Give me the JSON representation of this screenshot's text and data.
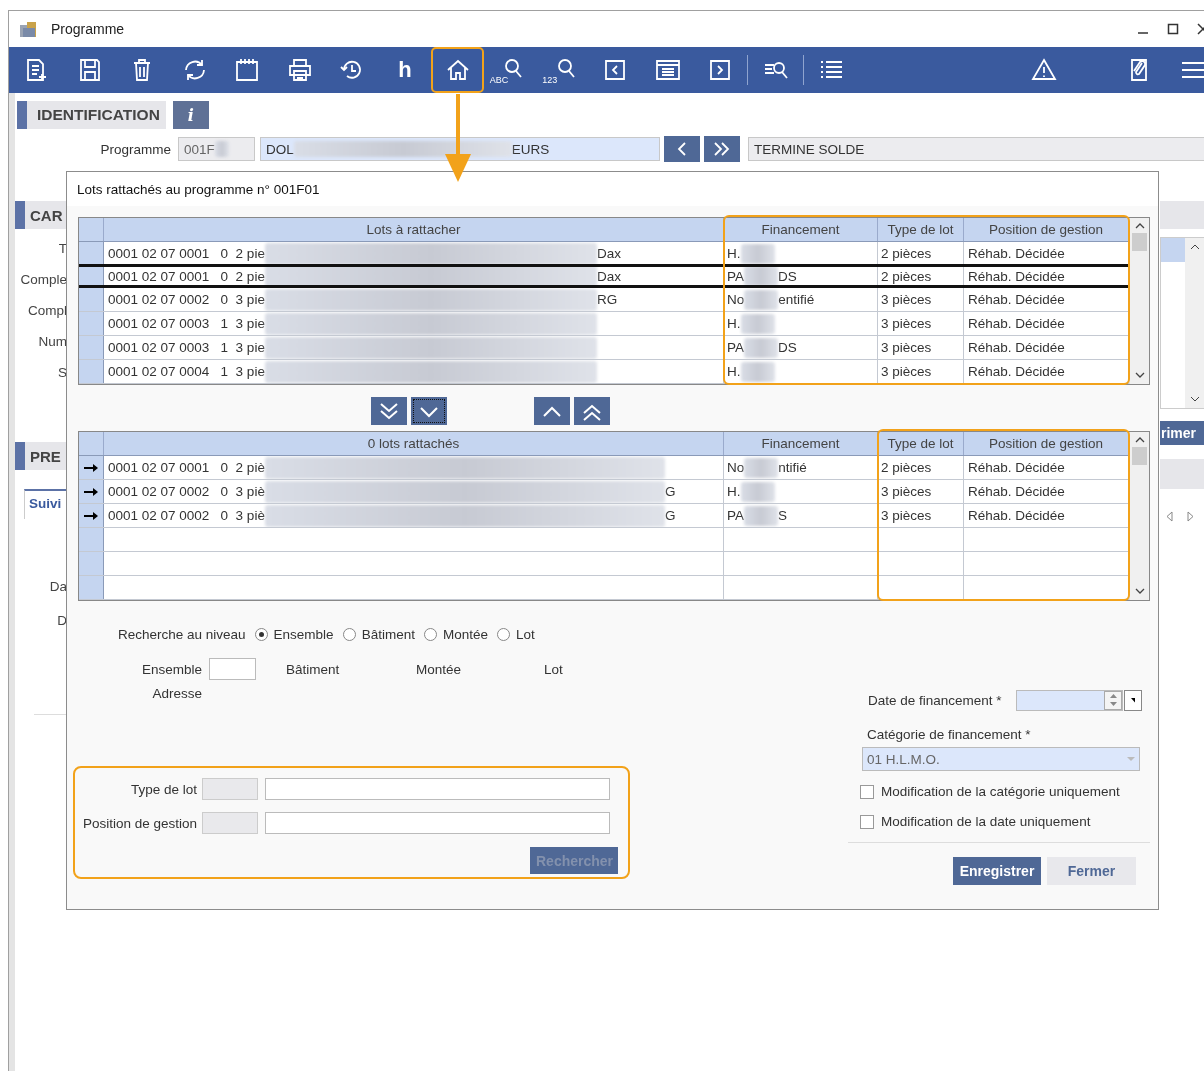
{
  "window": {
    "title": "Programme"
  },
  "toolbar": [
    {
      "kind": "new-document",
      "highlighted": false
    },
    {
      "kind": "save",
      "highlighted": false
    },
    {
      "kind": "trash",
      "highlighted": false
    },
    {
      "kind": "refresh",
      "highlighted": false
    },
    {
      "kind": "calendar",
      "highlighted": false
    },
    {
      "kind": "printer",
      "highlighted": false
    },
    {
      "kind": "history",
      "highlighted": false
    },
    {
      "kind": "letter",
      "label": "h",
      "highlighted": false
    },
    {
      "kind": "home",
      "highlighted": true
    },
    {
      "kind": "search-text",
      "label": "ABC",
      "highlighted": false
    },
    {
      "kind": "search-number",
      "label": "123",
      "highlighted": false
    },
    {
      "kind": "previous",
      "highlighted": false
    },
    {
      "kind": "window-list",
      "highlighted": false
    },
    {
      "kind": "next",
      "highlighted": false
    },
    {
      "kind": "separator"
    },
    {
      "kind": "filter-search",
      "highlighted": false
    },
    {
      "kind": "separator"
    },
    {
      "kind": "list",
      "highlighted": false
    },
    {
      "kind": "warning",
      "highlighted": false
    },
    {
      "kind": "attachment",
      "highlighted": false
    },
    {
      "kind": "menu",
      "highlighted": false
    }
  ],
  "identification": {
    "title": "IDENTIFICATION",
    "info": "i",
    "program_label": "Programme",
    "code": "001F",
    "name_start": "DOL",
    "name_end": "EURS",
    "status": "TERMINE SOLDE"
  },
  "background": {
    "section_1": "CAR",
    "labels_1": [
      "T",
      "Comple",
      "Compl",
      "Num",
      "S"
    ],
    "section_2": "PRE",
    "tab": "Suivi",
    "labels_2": [
      "Da",
      "D"
    ],
    "button": "rimer"
  },
  "dialog": {
    "title": "Lots rattachés au programme n° 001F01",
    "available": {
      "columns": [
        {
          "label": "Lots à rattacher",
          "highlighted": false
        },
        {
          "label": "Financement",
          "highlighted": true
        },
        {
          "label": "Type de lot",
          "highlighted": true
        },
        {
          "label": "Position de gestion",
          "highlighted": true
        }
      ],
      "rows": [
        {
          "lot": "0001 02 07 0001   0  2 pie",
          "lot_end": "Dax",
          "fin_start": "H.",
          "fin_end": "",
          "type": "2 pièces",
          "position": "Réhab. Décidée",
          "selected": false,
          "current": false
        },
        {
          "lot": "0001 02 07 0001   0  2 pie",
          "lot_end": "Dax",
          "fin_start": "PA",
          "fin_end": "DS",
          "type": "2 pièces",
          "position": "Réhab. Décidée",
          "selected": true,
          "current": false
        },
        {
          "lot": "0001 02 07 0002   0  3 pie",
          "lot_end": "RG",
          "fin_start": "No",
          "fin_end": "entifié",
          "type": "3 pièces",
          "position": "Réhab. Décidée",
          "selected": false,
          "current": false
        },
        {
          "lot": "0001 02 07 0003   1  3 pie",
          "lot_end": "",
          "fin_start": "H.",
          "fin_end": "",
          "type": "3 pièces",
          "position": "Réhab. Décidée",
          "selected": false,
          "current": false
        },
        {
          "lot": "0001 02 07 0003   1  3 pie",
          "lot_end": "",
          "fin_start": "PA",
          "fin_end": "DS",
          "type": "3 pièces",
          "position": "Réhab. Décidée",
          "selected": false,
          "current": false
        },
        {
          "lot": "0001 02 07 0004   1  3 pie",
          "lot_end": "",
          "fin_start": "H.",
          "fin_end": "",
          "type": "3 pièces",
          "position": "Réhab. Décidée",
          "selected": false,
          "current": false
        }
      ]
    },
    "attached": {
      "columns": [
        {
          "label": "0 lots rattachés",
          "highlighted": false
        },
        {
          "label": "Financement",
          "highlighted": false
        },
        {
          "label": "Type de lot",
          "highlighted": true
        },
        {
          "label": "Position de gestion",
          "highlighted": true
        }
      ],
      "rows": [
        {
          "lot": "0001 02 07 0001   0  2 piè",
          "lot_end": "",
          "fin_start": "No",
          "fin_end": "ntifié",
          "type": "2 pièces",
          "position": "Réhab. Décidée",
          "selected": false,
          "current": true
        },
        {
          "lot": "0001 02 07 0002   0  3 piè",
          "lot_end": "G",
          "fin_start": "H.",
          "fin_end": "",
          "type": "3 pièces",
          "position": "Réhab. Décidée",
          "selected": false,
          "current": true
        },
        {
          "lot": "0001 02 07 0002   0  3 piè",
          "lot_end": "G",
          "fin_start": "PA",
          "fin_end": "S",
          "type": "3 pièces",
          "position": "Réhab. Décidée",
          "selected": false,
          "current": true
        }
      ]
    },
    "move_buttons": [
      {
        "kind": "all-down",
        "focused": false
      },
      {
        "kind": "down",
        "focused": true
      },
      {
        "kind": "up",
        "focused": false
      },
      {
        "kind": "all-up",
        "focused": false
      }
    ],
    "search": {
      "level_label": "Recherche au niveau",
      "levels": [
        {
          "label": "Ensemble",
          "selected": true
        },
        {
          "label": "Bâtiment",
          "selected": false
        },
        {
          "label": "Montée",
          "selected": false
        },
        {
          "label": "Lot",
          "selected": false
        }
      ],
      "ensemble_label": "Ensemble",
      "batiment_label": "Bâtiment",
      "montee_label": "Montée",
      "lot_label": "Lot",
      "address_label": "Adresse",
      "highlighted": true,
      "type_label": "Type de lot",
      "position_label": "Position de gestion",
      "button": {
        "label": "Rechercher",
        "disabled": true
      }
    },
    "financing": {
      "date_label": "Date de financement *",
      "category_label": "Catégorie de financement *",
      "category": "01 H.L.M.O.",
      "options": [
        {
          "label": "Modification de la catégorie uniquement",
          "checked": false
        },
        {
          "label": "Modification de la date uniquement",
          "checked": false
        }
      ]
    },
    "buttons": [
      {
        "label": "Enregistrer",
        "kind": "primary"
      },
      {
        "label": "Fermer",
        "kind": "secondary"
      }
    ]
  }
}
